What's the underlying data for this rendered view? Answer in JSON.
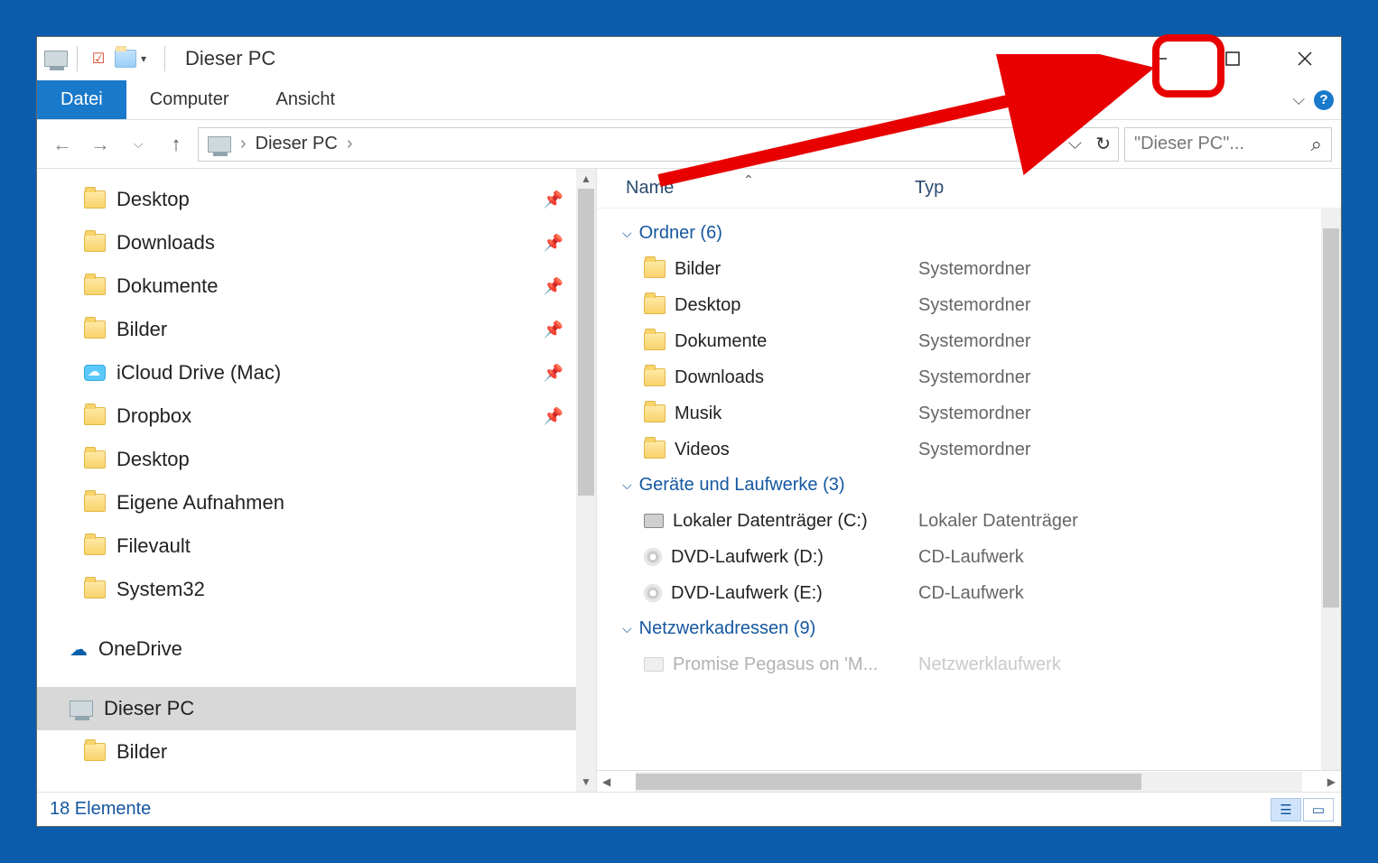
{
  "title": "Dieser PC",
  "ribbon": {
    "tabs": [
      "Datei",
      "Computer",
      "Ansicht"
    ],
    "active": 0
  },
  "nav": {
    "address_parts": [
      "Dieser PC"
    ],
    "search_placeholder": "\"Dieser PC\"..."
  },
  "navpane": {
    "items": [
      {
        "label": "Desktop",
        "icon": "folder",
        "pinned": true,
        "indent": 1
      },
      {
        "label": "Downloads",
        "icon": "folder",
        "pinned": true,
        "indent": 1
      },
      {
        "label": "Dokumente",
        "icon": "folder",
        "pinned": true,
        "indent": 1
      },
      {
        "label": "Bilder",
        "icon": "folder",
        "pinned": true,
        "indent": 1
      },
      {
        "label": "iCloud Drive (Mac)",
        "icon": "icloud",
        "pinned": true,
        "indent": 1
      },
      {
        "label": "Dropbox",
        "icon": "folder",
        "pinned": true,
        "indent": 1
      },
      {
        "label": "Desktop",
        "icon": "folder",
        "pinned": false,
        "indent": 1
      },
      {
        "label": "Eigene Aufnahmen",
        "icon": "folder",
        "pinned": false,
        "indent": 1
      },
      {
        "label": "Filevault",
        "icon": "folder",
        "pinned": false,
        "indent": 1
      },
      {
        "label": "System32",
        "icon": "folder",
        "pinned": false,
        "indent": 1
      },
      {
        "label": "OneDrive",
        "icon": "onedrive",
        "pinned": false,
        "indent": 0,
        "group": true
      },
      {
        "label": "Dieser PC",
        "icon": "pc",
        "pinned": false,
        "indent": 0,
        "group": true,
        "selected": true
      },
      {
        "label": "Bilder",
        "icon": "folder",
        "pinned": false,
        "indent": 1
      }
    ]
  },
  "columns": {
    "name": "Name",
    "type": "Typ"
  },
  "content": {
    "groups": [
      {
        "label": "Ordner",
        "count": 6,
        "items": [
          {
            "name": "Bilder",
            "type": "Systemordner",
            "icon": "folder"
          },
          {
            "name": "Desktop",
            "type": "Systemordner",
            "icon": "folder"
          },
          {
            "name": "Dokumente",
            "type": "Systemordner",
            "icon": "folder"
          },
          {
            "name": "Downloads",
            "type": "Systemordner",
            "icon": "folder"
          },
          {
            "name": "Musik",
            "type": "Systemordner",
            "icon": "folder"
          },
          {
            "name": "Videos",
            "type": "Systemordner",
            "icon": "folder"
          }
        ]
      },
      {
        "label": "Geräte und Laufwerke",
        "count": 3,
        "items": [
          {
            "name": "Lokaler Datenträger (C:)",
            "type": "Lokaler Datenträger",
            "icon": "drive"
          },
          {
            "name": "DVD-Laufwerk (D:)",
            "type": "CD-Laufwerk",
            "icon": "disc"
          },
          {
            "name": "DVD-Laufwerk (E:)",
            "type": "CD-Laufwerk",
            "icon": "disc"
          }
        ]
      },
      {
        "label": "Netzwerkadressen",
        "count": 9,
        "items": [
          {
            "name": "Promise Pegasus on 'M...",
            "type": "Netzwerklaufwerk",
            "icon": "drive",
            "faded": true
          }
        ]
      }
    ]
  },
  "status": {
    "text": "18 Elemente"
  }
}
